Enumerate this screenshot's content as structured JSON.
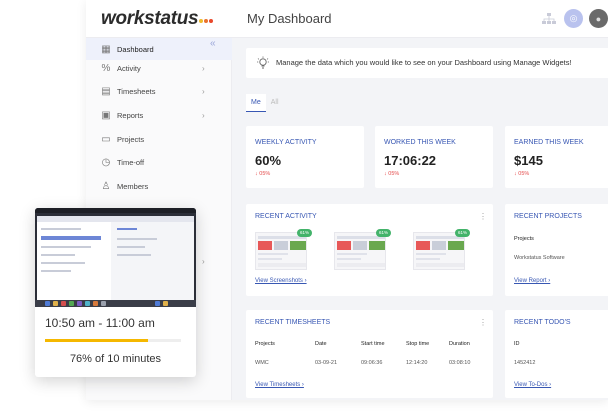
{
  "app": {
    "brand": "workstatus",
    "brand_dots": [
      "#f1bb2b",
      "#e9722e",
      "#e9482b"
    ],
    "page_title": "My Dashboard",
    "accent": "#3857b3"
  },
  "topbar": {
    "icons": [
      "org-chart-icon",
      "globe-icon",
      "user-avatar"
    ]
  },
  "sidebar": {
    "collapse_icon": "double-chevron-left-icon",
    "items": [
      {
        "label": "Dashboard",
        "icon": "grid-icon",
        "expandable": false,
        "active": true
      },
      {
        "label": "Activity",
        "icon": "activity-icon",
        "expandable": true
      },
      {
        "label": "Timesheets",
        "icon": "timesheet-icon",
        "expandable": true
      },
      {
        "label": "Reports",
        "icon": "report-icon",
        "expandable": true
      },
      {
        "label": "Projects",
        "icon": "folder-icon",
        "expandable": false
      },
      {
        "label": "Time-off",
        "icon": "clock-icon",
        "expandable": false
      },
      {
        "label": "Members",
        "icon": "person-icon",
        "expandable": false
      }
    ]
  },
  "banner": {
    "text": "Manage the data which you would like to see on your Dashboard using Manage Widgets!",
    "icon": "lightbulb-icon"
  },
  "tabs": [
    {
      "label": "Me",
      "active": true
    },
    {
      "label": "All",
      "active": false
    }
  ],
  "stats": [
    {
      "label": "WEEKLY ACTIVITY",
      "value": "60%",
      "change": "↓ 05%"
    },
    {
      "label": "WORKED THIS WEEK",
      "value": "17:06:22",
      "change": "↓ 05%"
    },
    {
      "label": "EARNED THIS WEEK",
      "value": "$145",
      "change": "↓ 05%"
    }
  ],
  "recent_activity": {
    "title": "RECENT ACTIVITY",
    "screenshots": [
      {
        "badge": "61%"
      },
      {
        "badge": "61%"
      },
      {
        "badge": "61%"
      }
    ],
    "link": "View Screenshots ›"
  },
  "recent_projects": {
    "title": "RECENT PROJECTS",
    "column": "Projects",
    "rows": [
      "Workstatus Software"
    ],
    "link": "View Report ›"
  },
  "recent_timesheets": {
    "title": "RECENT TIMESHEETS",
    "columns": [
      "Projects",
      "Date",
      "Start time",
      "Stop time",
      "Duration"
    ],
    "rows": [
      [
        "WMC",
        "03-09-21",
        "09:06:36",
        "12:14:20",
        "03:08:10"
      ]
    ],
    "link": "View Timesheets ›"
  },
  "recent_todos": {
    "title": "RECENT TODO'S",
    "column": "ID",
    "rows": [
      "1452412"
    ],
    "link": "View To-Dos ›"
  },
  "floating_card": {
    "time_range": "10:50 am - 11:00 am",
    "progress_percent": 76,
    "progress_text": "76% of 10 minutes",
    "progress_color": "#f5b800"
  }
}
